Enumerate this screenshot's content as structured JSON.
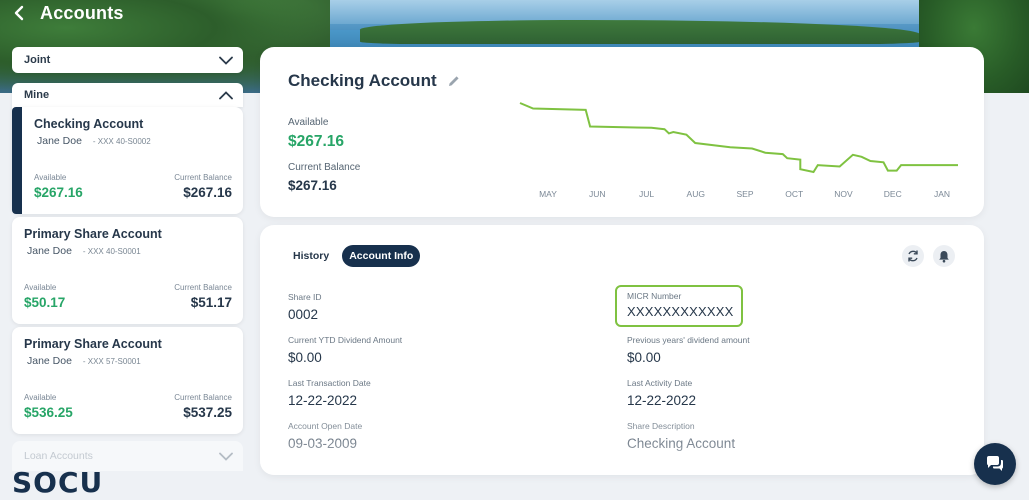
{
  "header": {
    "title": "Accounts"
  },
  "groups": {
    "joint": "Joint",
    "mine": "Mine",
    "loan": "Loan Accounts"
  },
  "accounts": [
    {
      "name": "Checking Account",
      "holder": "Jane Doe",
      "number": "- XXX 40-S0002",
      "available_label": "Available",
      "available": "$267.16",
      "balance_label": "Current Balance",
      "balance": "$267.16"
    },
    {
      "name": "Primary Share Account",
      "holder": "Jane Doe",
      "number": "- XXX 40-S0001",
      "available_label": "Available",
      "available": "$50.17",
      "balance_label": "Current Balance",
      "balance": "$51.17"
    },
    {
      "name": "Primary Share Account",
      "holder": "Jane Doe",
      "number": "- XXX 57-S0001",
      "available_label": "Available",
      "available": "$536.25",
      "balance_label": "Current Balance",
      "balance": "$537.25"
    }
  ],
  "logo": "SOCU",
  "detail": {
    "title": "Checking Account",
    "available_label": "Available",
    "available": "$267.16",
    "balance_label": "Current Balance",
    "balance": "$267.16"
  },
  "chart_data": {
    "type": "line",
    "x": [
      "MAY",
      "JUN",
      "JUL",
      "AUG",
      "SEP",
      "OCT",
      "NOV",
      "DEC",
      "JAN"
    ],
    "color": "#7fc241",
    "points": [
      [
        0.0,
        1.0
      ],
      [
        0.03,
        0.92
      ],
      [
        0.15,
        0.9
      ],
      [
        0.16,
        0.66
      ],
      [
        0.3,
        0.64
      ],
      [
        0.33,
        0.62
      ],
      [
        0.34,
        0.56
      ],
      [
        0.35,
        0.58
      ],
      [
        0.38,
        0.54
      ],
      [
        0.4,
        0.42
      ],
      [
        0.48,
        0.36
      ],
      [
        0.53,
        0.34
      ],
      [
        0.56,
        0.28
      ],
      [
        0.6,
        0.26
      ],
      [
        0.61,
        0.2
      ],
      [
        0.64,
        0.18
      ],
      [
        0.64,
        0.04
      ],
      [
        0.67,
        0.0
      ],
      [
        0.68,
        0.1
      ],
      [
        0.73,
        0.08
      ],
      [
        0.76,
        0.25
      ],
      [
        0.78,
        0.22
      ],
      [
        0.8,
        0.16
      ],
      [
        0.83,
        0.14
      ],
      [
        0.84,
        0.02
      ],
      [
        0.86,
        0.02
      ],
      [
        0.87,
        0.1
      ],
      [
        0.94,
        0.1
      ],
      [
        1.0,
        0.1
      ]
    ]
  },
  "tabs": {
    "history": "History",
    "info": "Account Info"
  },
  "info": {
    "share_id_label": "Share ID",
    "share_id": "0002",
    "micr_label": "MICR Number",
    "micr": "XXXXXXXXXXXX",
    "ytd_label": "Current YTD Dividend Amount",
    "ytd": "$0.00",
    "prev_label": "Previous years' dividend amount",
    "prev": "$0.00",
    "last_tx_label": "Last Transaction Date",
    "last_tx": "12-22-2022",
    "last_act_label": "Last Activity Date",
    "last_act": "12-22-2022",
    "open_label": "Account Open Date",
    "open": "09-03-2009",
    "desc_label": "Share Description",
    "desc": "Checking Account"
  },
  "icons": {
    "refresh": "refresh-icon",
    "bell": "bell-icon",
    "chat": "chat-icon",
    "pencil": "pencil-icon"
  }
}
